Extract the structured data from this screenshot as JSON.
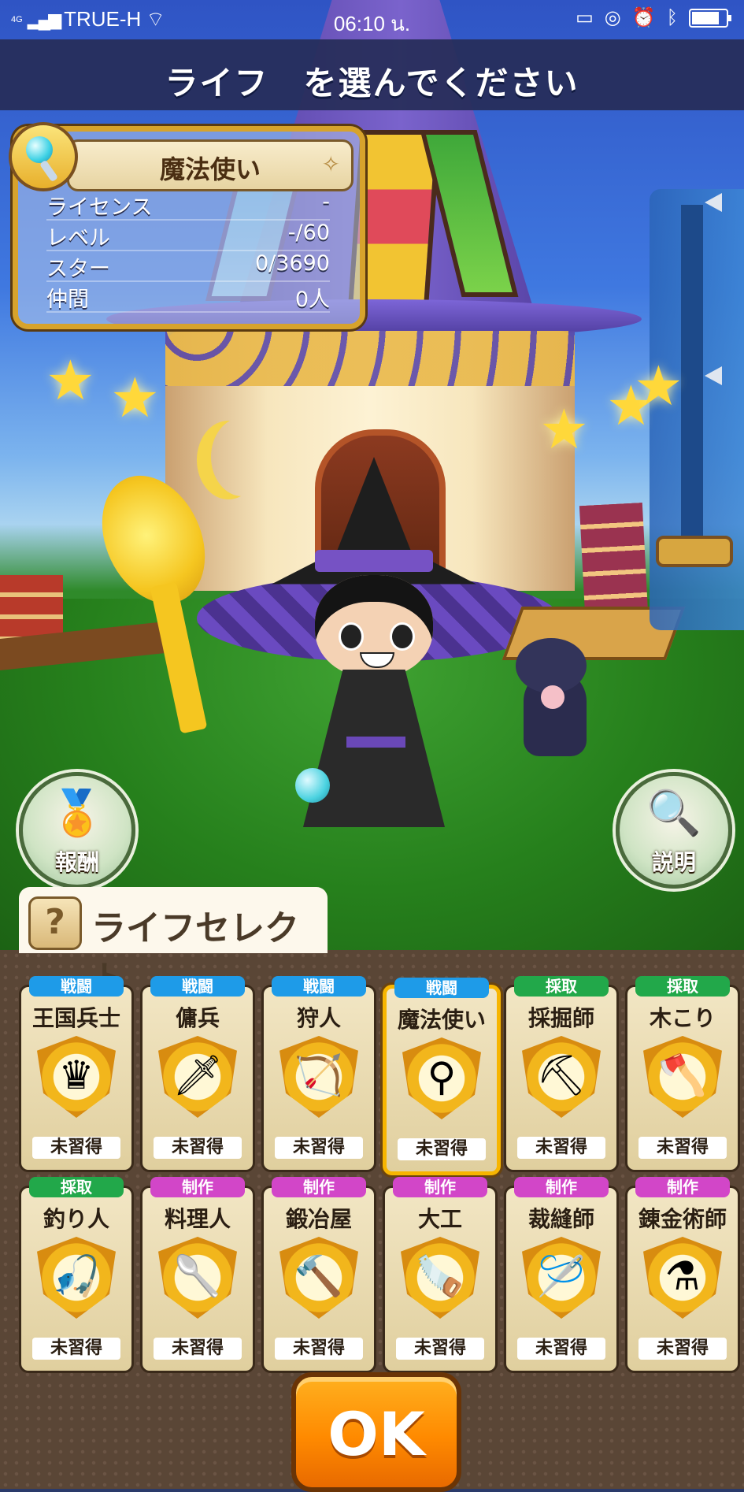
{
  "status_bar": {
    "network": "4G",
    "carrier": "TRUE-H",
    "time": "06:10 น.",
    "battery_level": 0.8
  },
  "header": {
    "title": "ライフ　を選んでください"
  },
  "info_card": {
    "name": "魔法使い",
    "rows": [
      {
        "label": "ライセンス",
        "value": "-"
      },
      {
        "label": "レベル",
        "value": "-/60"
      },
      {
        "label": "スター",
        "value": "0/3690"
      },
      {
        "label": "仲間",
        "value": "0人"
      }
    ]
  },
  "buttons": {
    "reward": "報酬",
    "explain": "説明",
    "ok": "OK"
  },
  "life_select": {
    "tab_label": "ライフセレクト",
    "tab_icon": "?"
  },
  "categories": {
    "battle": {
      "label": "戦闘",
      "color": "#1e9be8"
    },
    "gather": {
      "label": "採取",
      "color": "#22a84a"
    },
    "craft": {
      "label": "制作",
      "color": "#d246c8"
    }
  },
  "jobs": [
    {
      "name": "王国兵士",
      "category": "戦闘",
      "icon": "crown-shield-icon",
      "glyph": "♛",
      "status": "未習得"
    },
    {
      "name": "傭兵",
      "category": "戦闘",
      "icon": "sword-icon",
      "glyph": "🗡",
      "status": "未習得"
    },
    {
      "name": "狩人",
      "category": "戦闘",
      "icon": "bow-icon",
      "glyph": "🏹",
      "status": "未習得"
    },
    {
      "name": "魔法使い",
      "category": "戦闘",
      "icon": "magic-wand-icon",
      "glyph": "⚲",
      "status": "未習得",
      "selected": true
    },
    {
      "name": "採掘師",
      "category": "採取",
      "icon": "pickaxe-icon",
      "glyph": "⛏",
      "status": "未習得"
    },
    {
      "name": "木こり",
      "category": "採取",
      "icon": "axe-icon",
      "glyph": "🪓",
      "status": "未習得"
    },
    {
      "name": "釣り人",
      "category": "採取",
      "icon": "fishing-rod-icon",
      "glyph": "🎣",
      "status": "未習得"
    },
    {
      "name": "料理人",
      "category": "制作",
      "icon": "ladle-icon",
      "glyph": "🥄",
      "status": "未習得"
    },
    {
      "name": "鍛冶屋",
      "category": "制作",
      "icon": "hammer-icon",
      "glyph": "🔨",
      "status": "未習得"
    },
    {
      "name": "大工",
      "category": "制作",
      "icon": "saw-icon",
      "glyph": "🪚",
      "status": "未習得"
    },
    {
      "name": "裁縫師",
      "category": "制作",
      "icon": "needle-icon",
      "glyph": "🪡",
      "status": "未習得"
    },
    {
      "name": "錬金術師",
      "category": "制作",
      "icon": "flask-icon",
      "glyph": "⚗",
      "status": "未習得"
    }
  ]
}
